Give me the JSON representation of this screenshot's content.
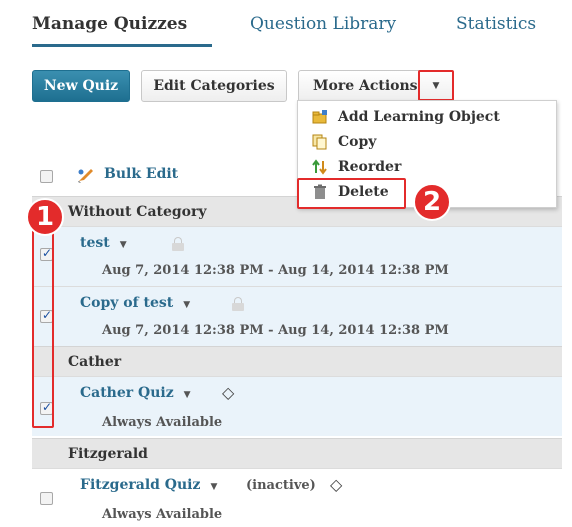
{
  "tabs": [
    {
      "label": "Manage Quizzes",
      "active": true
    },
    {
      "label": "Question Library",
      "active": false
    },
    {
      "label": "Statistics",
      "active": false
    }
  ],
  "toolbar": {
    "new_quiz": "New Quiz",
    "edit_categories": "Edit Categories",
    "more_actions": "More Actions"
  },
  "menu": {
    "items": [
      {
        "label": "Add Learning Object",
        "icon": "folder-add-icon"
      },
      {
        "label": "Copy",
        "icon": "copy-icon"
      },
      {
        "label": "Reorder",
        "icon": "reorder-icon"
      },
      {
        "label": "Delete",
        "icon": "trash-icon"
      }
    ]
  },
  "bulk_edit": "Bulk Edit",
  "sections": [
    {
      "name": "Without Category"
    },
    {
      "name": "Cather"
    },
    {
      "name": "Fitzgerald"
    }
  ],
  "quizzes": [
    {
      "name": "test",
      "sub": "Aug 7, 2014 12:38 PM - Aug 14, 2014 12:38 PM",
      "checked": true
    },
    {
      "name": "Copy of test",
      "sub": "Aug 7, 2014 12:38 PM - Aug 14, 2014 12:38 PM",
      "checked": true
    },
    {
      "name": "Cather Quiz",
      "sub": "Always Available",
      "checked": true
    },
    {
      "name": "Fitzgerald Quiz",
      "sub": "Always Available",
      "status": "(inactive)",
      "checked": false
    }
  ],
  "callouts": {
    "one": "1",
    "two": "2"
  },
  "colors": {
    "accent": "#2a6a8c",
    "callout": "#e32b2b",
    "selected_row": "#eaf3fa"
  }
}
